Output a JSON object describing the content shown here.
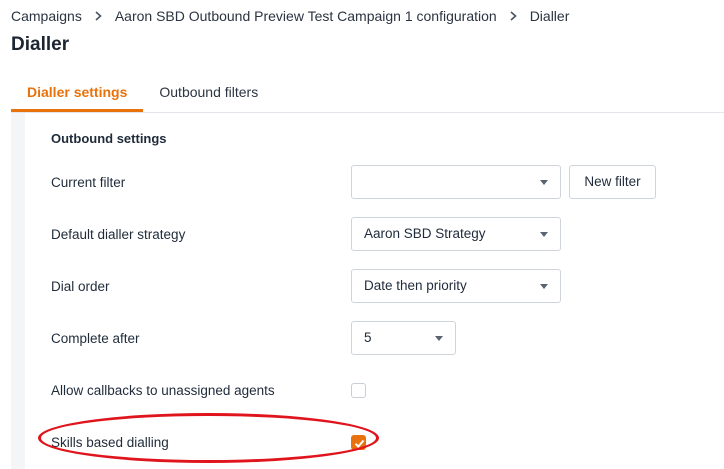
{
  "breadcrumb": {
    "items": [
      "Campaigns",
      "Aaron SBD Outbound Preview Test Campaign 1 configuration",
      "Dialler"
    ]
  },
  "page": {
    "title": "Dialler"
  },
  "tabs": [
    {
      "label": "Dialler settings",
      "active": true
    },
    {
      "label": "Outbound filters",
      "active": false
    }
  ],
  "outbound_settings": {
    "title": "Outbound settings",
    "current_filter": {
      "label": "Current filter",
      "value": "",
      "new_filter_label": "New filter"
    },
    "default_dialler_strategy": {
      "label": "Default dialler strategy",
      "value": "Aaron SBD Strategy"
    },
    "dial_order": {
      "label": "Dial order",
      "value": "Date then priority"
    },
    "complete_after": {
      "label": "Complete after",
      "value": "5"
    },
    "allow_callbacks": {
      "label": "Allow callbacks to unassigned agents",
      "checked": false
    },
    "skills_based_dialling": {
      "label": "Skills based dialling",
      "checked": true
    }
  },
  "colors": {
    "accent": "#e8720c",
    "highlight": "#e0141c"
  },
  "icons": {
    "breadcrumb_separator": "chevron-right-icon",
    "select_caret": "caret-down-icon",
    "check": "check-icon"
  }
}
